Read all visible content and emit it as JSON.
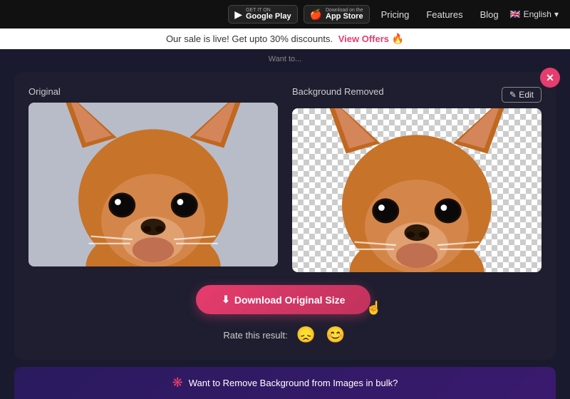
{
  "navbar": {
    "google_play_top": "GET IT ON",
    "google_play_bottom": "Google Play",
    "app_store_top": "Download on the",
    "app_store_bottom": "App Store",
    "pricing": "Pricing",
    "features": "Features",
    "blog": "Blog",
    "language": "English"
  },
  "sale_banner": {
    "text": "Our sale is live! Get upto 30% discounts.",
    "link_text": "View Offers",
    "emoji": "🔥"
  },
  "main": {
    "original_label": "Original",
    "bg_removed_label": "Background Removed",
    "edit_label": "✎ Edit",
    "download_label": "Download Original Size",
    "rating_label": "Rate this result:",
    "sad_emoji": "😞",
    "happy_emoji": "😊",
    "close_symbol": "✕"
  },
  "promo": {
    "icon": "❋",
    "text": "Want to Remove Background from Images in bulk?"
  },
  "top_hint": "Want to..."
}
